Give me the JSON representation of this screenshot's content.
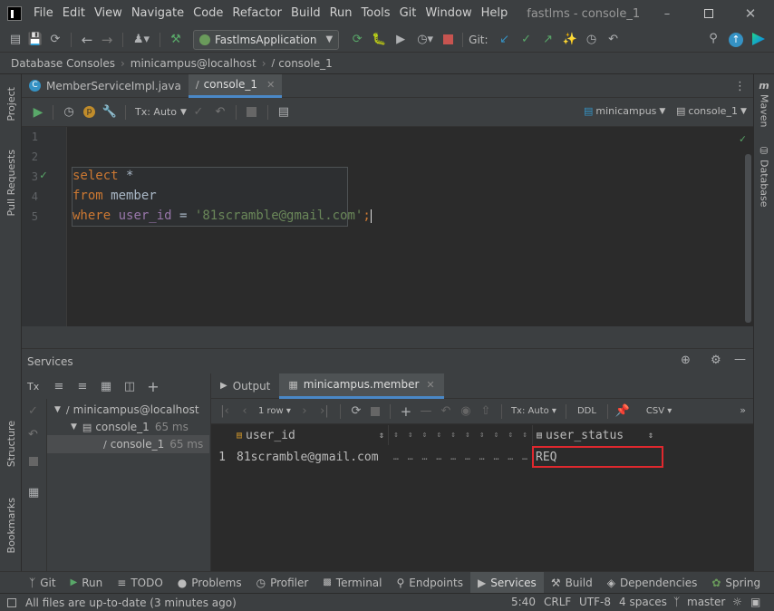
{
  "menu": [
    "File",
    "Edit",
    "View",
    "Navigate",
    "Code",
    "Refactor",
    "Build",
    "Run",
    "Tools",
    "Git",
    "Window",
    "Help"
  ],
  "window_title": "fastlms - console_1",
  "toolbar": {
    "run_config": "FastlmsApplication",
    "git_label": "Git:"
  },
  "breadcrumb": [
    "Database Consoles",
    "minicampus@localhost",
    "console_1"
  ],
  "left_tools": [
    "Project",
    "Pull Requests",
    "Structure",
    "Bookmarks"
  ],
  "right_tools": [
    "Maven",
    "Database"
  ],
  "editor_tabs": [
    {
      "label": "MemberServiceImpl.java"
    },
    {
      "label": "console_1"
    }
  ],
  "editor_toolbar": {
    "tx": "Tx: Auto",
    "datasource": "minicampus",
    "console": "console_1"
  },
  "code": {
    "line_numbers": [
      "1",
      "2",
      "3",
      "4",
      "5"
    ],
    "line3": {
      "kw": "select",
      "rest": " *"
    },
    "line4": {
      "kw": "from",
      "rest": " member"
    },
    "line5": {
      "kw": "where",
      "col": "user_id",
      "op": " = ",
      "str": "'81scramble@gmail.com'",
      "end": ";"
    }
  },
  "services": {
    "title": "Services",
    "tree": [
      {
        "label": "minicampus@localhost",
        "time": ""
      },
      {
        "label": "console_1",
        "time": "65 ms"
      },
      {
        "label": "console_1",
        "time": "65 ms"
      }
    ],
    "tabs": [
      "Output",
      "minicampus.member"
    ],
    "result_toolbar": {
      "rows": "1 row",
      "tx": "Tx: Auto",
      "ddl": "DDL",
      "csv": "CSV"
    },
    "table": {
      "columns": [
        "user_id",
        "user_status"
      ],
      "rows": [
        {
          "num": "1",
          "user_id": "81scramble@gmail.com",
          "user_status": "REQ"
        }
      ]
    }
  },
  "bottom_tools": [
    "Git",
    "Run",
    "TODO",
    "Problems",
    "Profiler",
    "Terminal",
    "Endpoints",
    "Services",
    "Build",
    "Dependencies",
    "Spring"
  ],
  "status": {
    "message": "All files are up-to-date (3 minutes ago)",
    "position": "5:40",
    "line_sep": "CRLF",
    "encoding": "UTF-8",
    "indent": "4 spaces",
    "branch": "master"
  },
  "colors": {
    "highlight_box": "#e0282e",
    "keyword": "#cc7832",
    "string": "#6a8759",
    "identifier": "#9876aa",
    "selected_tab": "#4a88c7"
  }
}
